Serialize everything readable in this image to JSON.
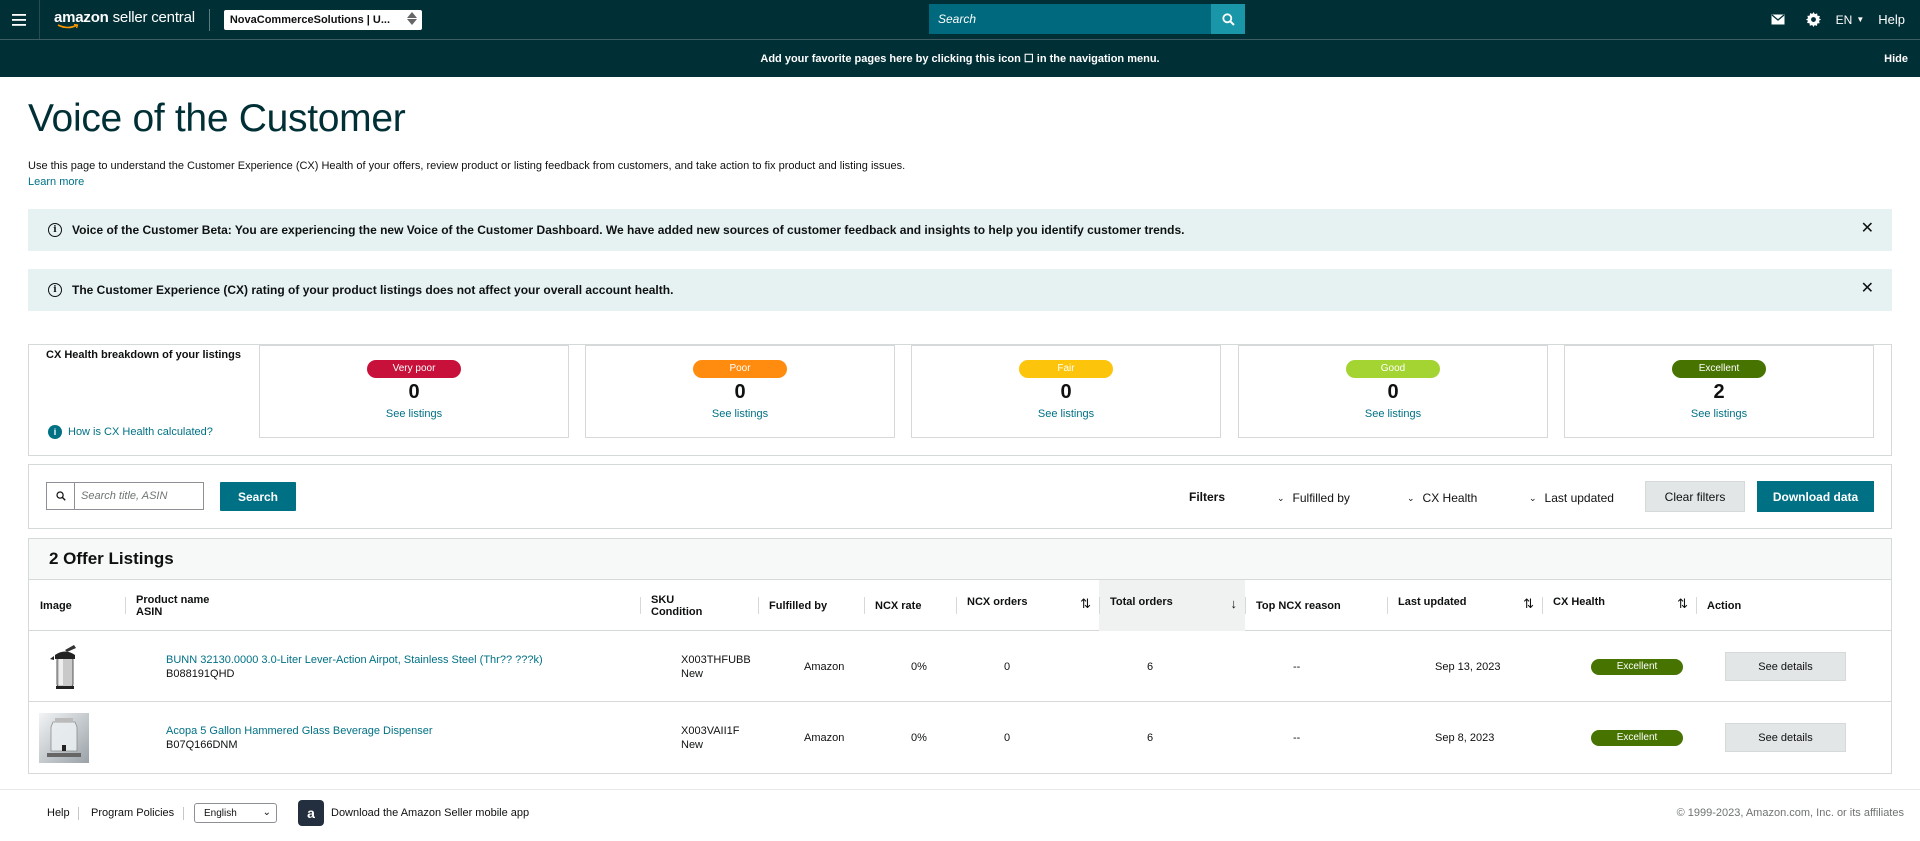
{
  "topnav": {
    "brand_amazon": "amazon",
    "brand_rest": " seller central",
    "account": "NovaCommerceSolutions | U...",
    "search_placeholder": "Search",
    "lang": "EN",
    "help": "Help",
    "icons": [
      "menu-icon",
      "search-icon",
      "mail-icon",
      "gear-icon",
      "chevron-down-icon"
    ]
  },
  "favbar": {
    "text": "Add your favorite pages here by clicking this icon ☐ in the navigation menu.",
    "hide": "Hide"
  },
  "page": {
    "title": "Voice of the Customer",
    "intro": "Use this page to understand the Customer Experience (CX) Health of your offers, review product or listing feedback from customers, and take action to fix product and listing issues.",
    "learn_more": "Learn more"
  },
  "alerts": [
    {
      "text": "Voice of the Customer Beta: You are experiencing the new Voice of the Customer Dashboard. We have added new sources of customer feedback and insights to help you identify customer trends."
    },
    {
      "text": "The Customer Experience (CX) rating of your product listings does not affect your overall account health."
    }
  ],
  "cx_health": {
    "heading": "CX Health breakdown of your listings",
    "how_link": "How is CX Health calculated?",
    "cards": [
      {
        "label": "Very poor",
        "count": "0",
        "link": "See listings",
        "color": "#c7103a"
      },
      {
        "label": "Poor",
        "count": "0",
        "link": "See listings",
        "color": "#ff8c0f"
      },
      {
        "label": "Fair",
        "count": "0",
        "link": "See listings",
        "color": "#fcc40a"
      },
      {
        "label": "Good",
        "count": "0",
        "link": "See listings",
        "color": "#a4d432"
      },
      {
        "label": "Excellent",
        "count": "2",
        "link": "See listings",
        "color": "#477300"
      }
    ]
  },
  "filters": {
    "search_placeholder": "Search title, ASIN",
    "search_btn": "Search",
    "label": "Filters",
    "dropdowns": [
      "Fulfilled by",
      "CX Health",
      "Last updated"
    ],
    "clear": "Clear filters",
    "download": "Download data"
  },
  "table": {
    "title": "2 Offer Listings",
    "headers": {
      "image": "Image",
      "product": "Product name",
      "asin": "ASIN",
      "sku": "SKU",
      "condition": "Condition",
      "fulfilled": "Fulfilled by",
      "ncx_rate": "NCX rate",
      "ncx_orders": "NCX orders",
      "total_orders": "Total orders",
      "top_reason": "Top NCX reason",
      "last_updated": "Last updated",
      "cx_health": "CX Health",
      "action": "Action"
    },
    "rows": [
      {
        "name": "BUNN 32130.0000 3.0-Liter Lever-Action Airpot, Stainless Steel (Thr?? ???k)",
        "asin": "B088191QHD",
        "sku": "X003THFUBB",
        "condition": "New",
        "fulfilled": "Amazon",
        "ncx_rate": "0%",
        "ncx_orders": "0",
        "total_orders": "6",
        "top_reason": "--",
        "last_updated": "Sep 13, 2023",
        "cx_health": "Excellent",
        "action": "See details",
        "thumb": "airpot-image"
      },
      {
        "name": "Acopa 5 Gallon Hammered Glass Beverage Dispenser",
        "asin": "B07Q166DNM",
        "sku": "X003VAII1F",
        "condition": "New",
        "fulfilled": "Amazon",
        "ncx_rate": "0%",
        "ncx_orders": "0",
        "total_orders": "6",
        "top_reason": "--",
        "last_updated": "Sep 8, 2023",
        "cx_health": "Excellent",
        "action": "See details",
        "thumb": "dispenser-image"
      }
    ]
  },
  "footer": {
    "help": "Help",
    "policies": "Program Policies",
    "language": "English",
    "app_text": "Download the Amazon Seller mobile app",
    "copyright": "© 1999-2023, Amazon.com, Inc. or its affiliates"
  }
}
